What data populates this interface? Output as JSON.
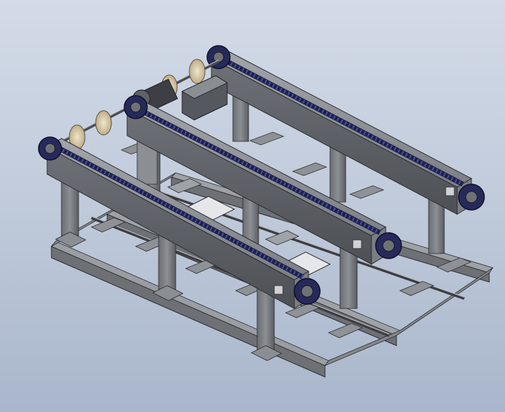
{
  "scene": {
    "subject": "",
    "colors": {
      "steel_dark": "#5b5e63",
      "steel_mid": "#7a7d83",
      "steel_light": "#9b9ea3",
      "chain_navy": "#1e2149",
      "chain_link": "#3a3f80",
      "plate_white": "#e6e7ea",
      "disc_tan": "#d8c9a6",
      "motor_dark": "#3d3f45"
    }
  }
}
